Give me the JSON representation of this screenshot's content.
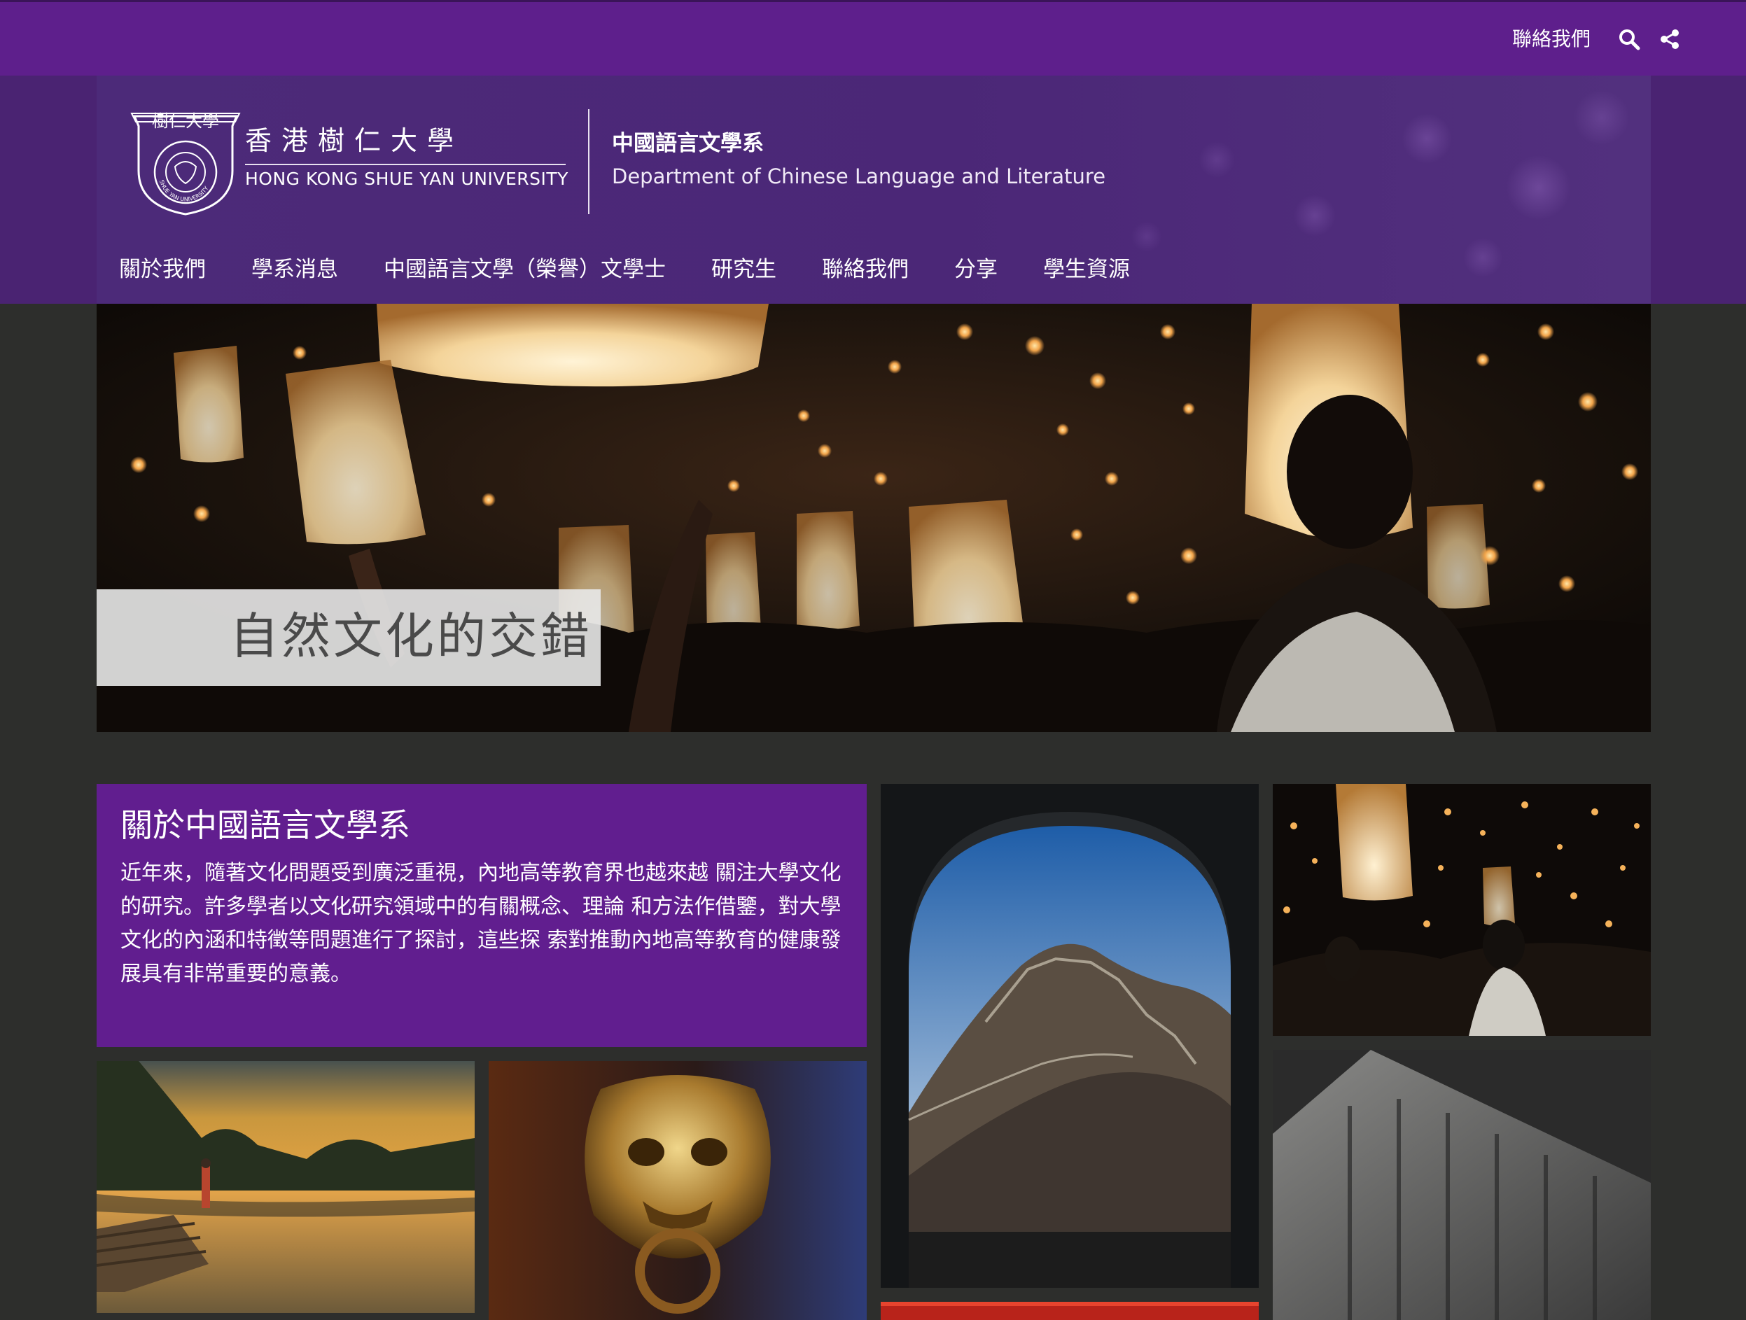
{
  "topbar": {
    "contact_label": "聯絡我們",
    "icons": [
      "search-icon",
      "share-icon"
    ]
  },
  "brand": {
    "crest_text": "樹仁大學",
    "crest_ring_text": "SHUE YAN UNIVERSITY",
    "name_cn": "香港樹仁大學",
    "name_en": "HONG KONG SHUE YAN UNIVERSITY"
  },
  "department": {
    "name_cn": "中國語言文學系",
    "name_en": "Department of Chinese Language and Literature"
  },
  "nav": {
    "items": [
      {
        "label": "關於我們"
      },
      {
        "label": "學系消息"
      },
      {
        "label": "中國語言文學（榮譽）文學士"
      },
      {
        "label": "研究生"
      },
      {
        "label": "聯絡我們"
      },
      {
        "label": "分享"
      },
      {
        "label": "學生資源"
      }
    ]
  },
  "hero": {
    "caption": "自然文化的交錯"
  },
  "about": {
    "title": "關於中國語言文學系",
    "body": "近年來，隨著文化問題受到廣泛重視，內地高等教育界也越來越 關注大學文化的研究。許多學者以文化研究領域中的有關概念、理論 和方法作借鑒，對大學文化的內涵和特徵等問題進行了探討，這些探 索對推動內地高等教育的健康發展具有非常重要的意義。"
  },
  "colors": {
    "topbar": "#5e1f8c",
    "header": "#4a2372",
    "about_box": "#611e8f",
    "page_background": "#2d2e2c"
  }
}
